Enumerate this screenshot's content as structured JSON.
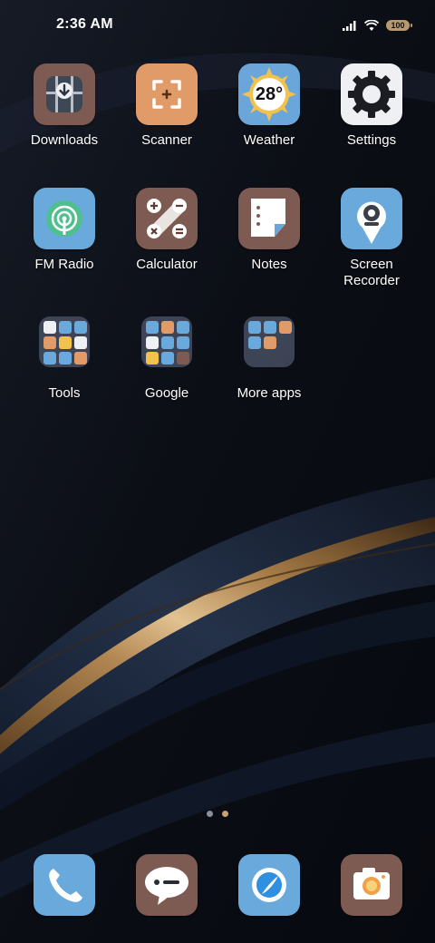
{
  "status_bar": {
    "time": "2:36 AM",
    "battery": "100",
    "icons": [
      "signal-icon",
      "wifi-icon",
      "battery-icon"
    ]
  },
  "apps": [
    {
      "label": "Downloads",
      "icon": "downloads-icon",
      "color": "#7e5b52"
    },
    {
      "label": "Scanner",
      "icon": "scanner-icon",
      "color": "#e09b68"
    },
    {
      "label": "Weather",
      "icon": "weather-icon",
      "color": "#6aa6d9",
      "temperature": "28°"
    },
    {
      "label": "Settings",
      "icon": "gear-icon",
      "color": "#eef0f4"
    },
    {
      "label": "FM Radio",
      "icon": "radio-icon",
      "color": "#69a9db"
    },
    {
      "label": "Calculator",
      "icon": "calculator-icon",
      "color": "#7e5b52"
    },
    {
      "label": "Notes",
      "icon": "notes-icon",
      "color": "#7e5b52"
    },
    {
      "label": "Screen Recorder",
      "icon": "screen-recorder-icon",
      "color": "#69a9db"
    }
  ],
  "folders": [
    {
      "label": "Tools"
    },
    {
      "label": "Google"
    },
    {
      "label": "More apps"
    }
  ],
  "page_indicator": {
    "pages": 2,
    "current": 2
  },
  "dock": [
    {
      "name": "phone",
      "icon": "phone-icon",
      "color": "#69a9db"
    },
    {
      "name": "messages",
      "icon": "message-icon",
      "color": "#7e5b52"
    },
    {
      "name": "browser",
      "icon": "browser-icon",
      "color": "#69a9db"
    },
    {
      "name": "camera",
      "icon": "camera-icon",
      "color": "#7e5b52"
    }
  ]
}
